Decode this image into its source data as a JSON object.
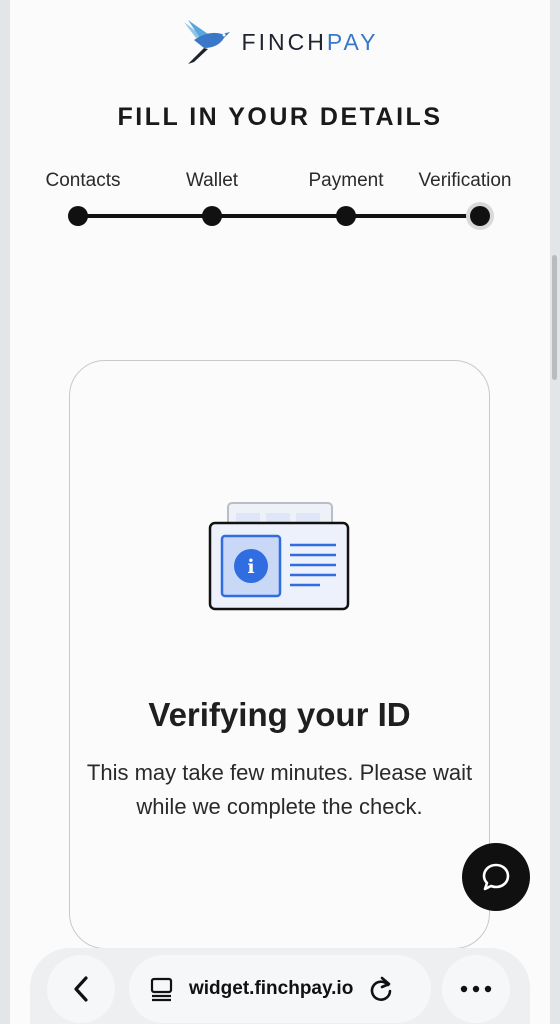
{
  "brand": {
    "name_part1": "FINCH",
    "name_part2": "PAY"
  },
  "page_title": "FILL IN YOUR DETAILS",
  "steps": [
    {
      "label": "Contacts"
    },
    {
      "label": "Wallet"
    },
    {
      "label": "Payment"
    },
    {
      "label": "Verification",
      "current": true
    }
  ],
  "card": {
    "title": "Verifying your ID",
    "subtitle": "This may take few minutes. Please wait while we complete the check.",
    "icon": "id-card-icon"
  },
  "chat": {
    "icon": "chat-bubble-icon"
  },
  "browser": {
    "url": "widget.finchpay.io",
    "back_icon": "chevron-left-icon",
    "tabs_icon": "tab-overview-icon",
    "reload_icon": "reload-icon",
    "more_icon": "more-icon"
  },
  "colors": {
    "accent": "#2f6de0",
    "brand_blue": "#3a78c7",
    "dark": "#111111"
  }
}
